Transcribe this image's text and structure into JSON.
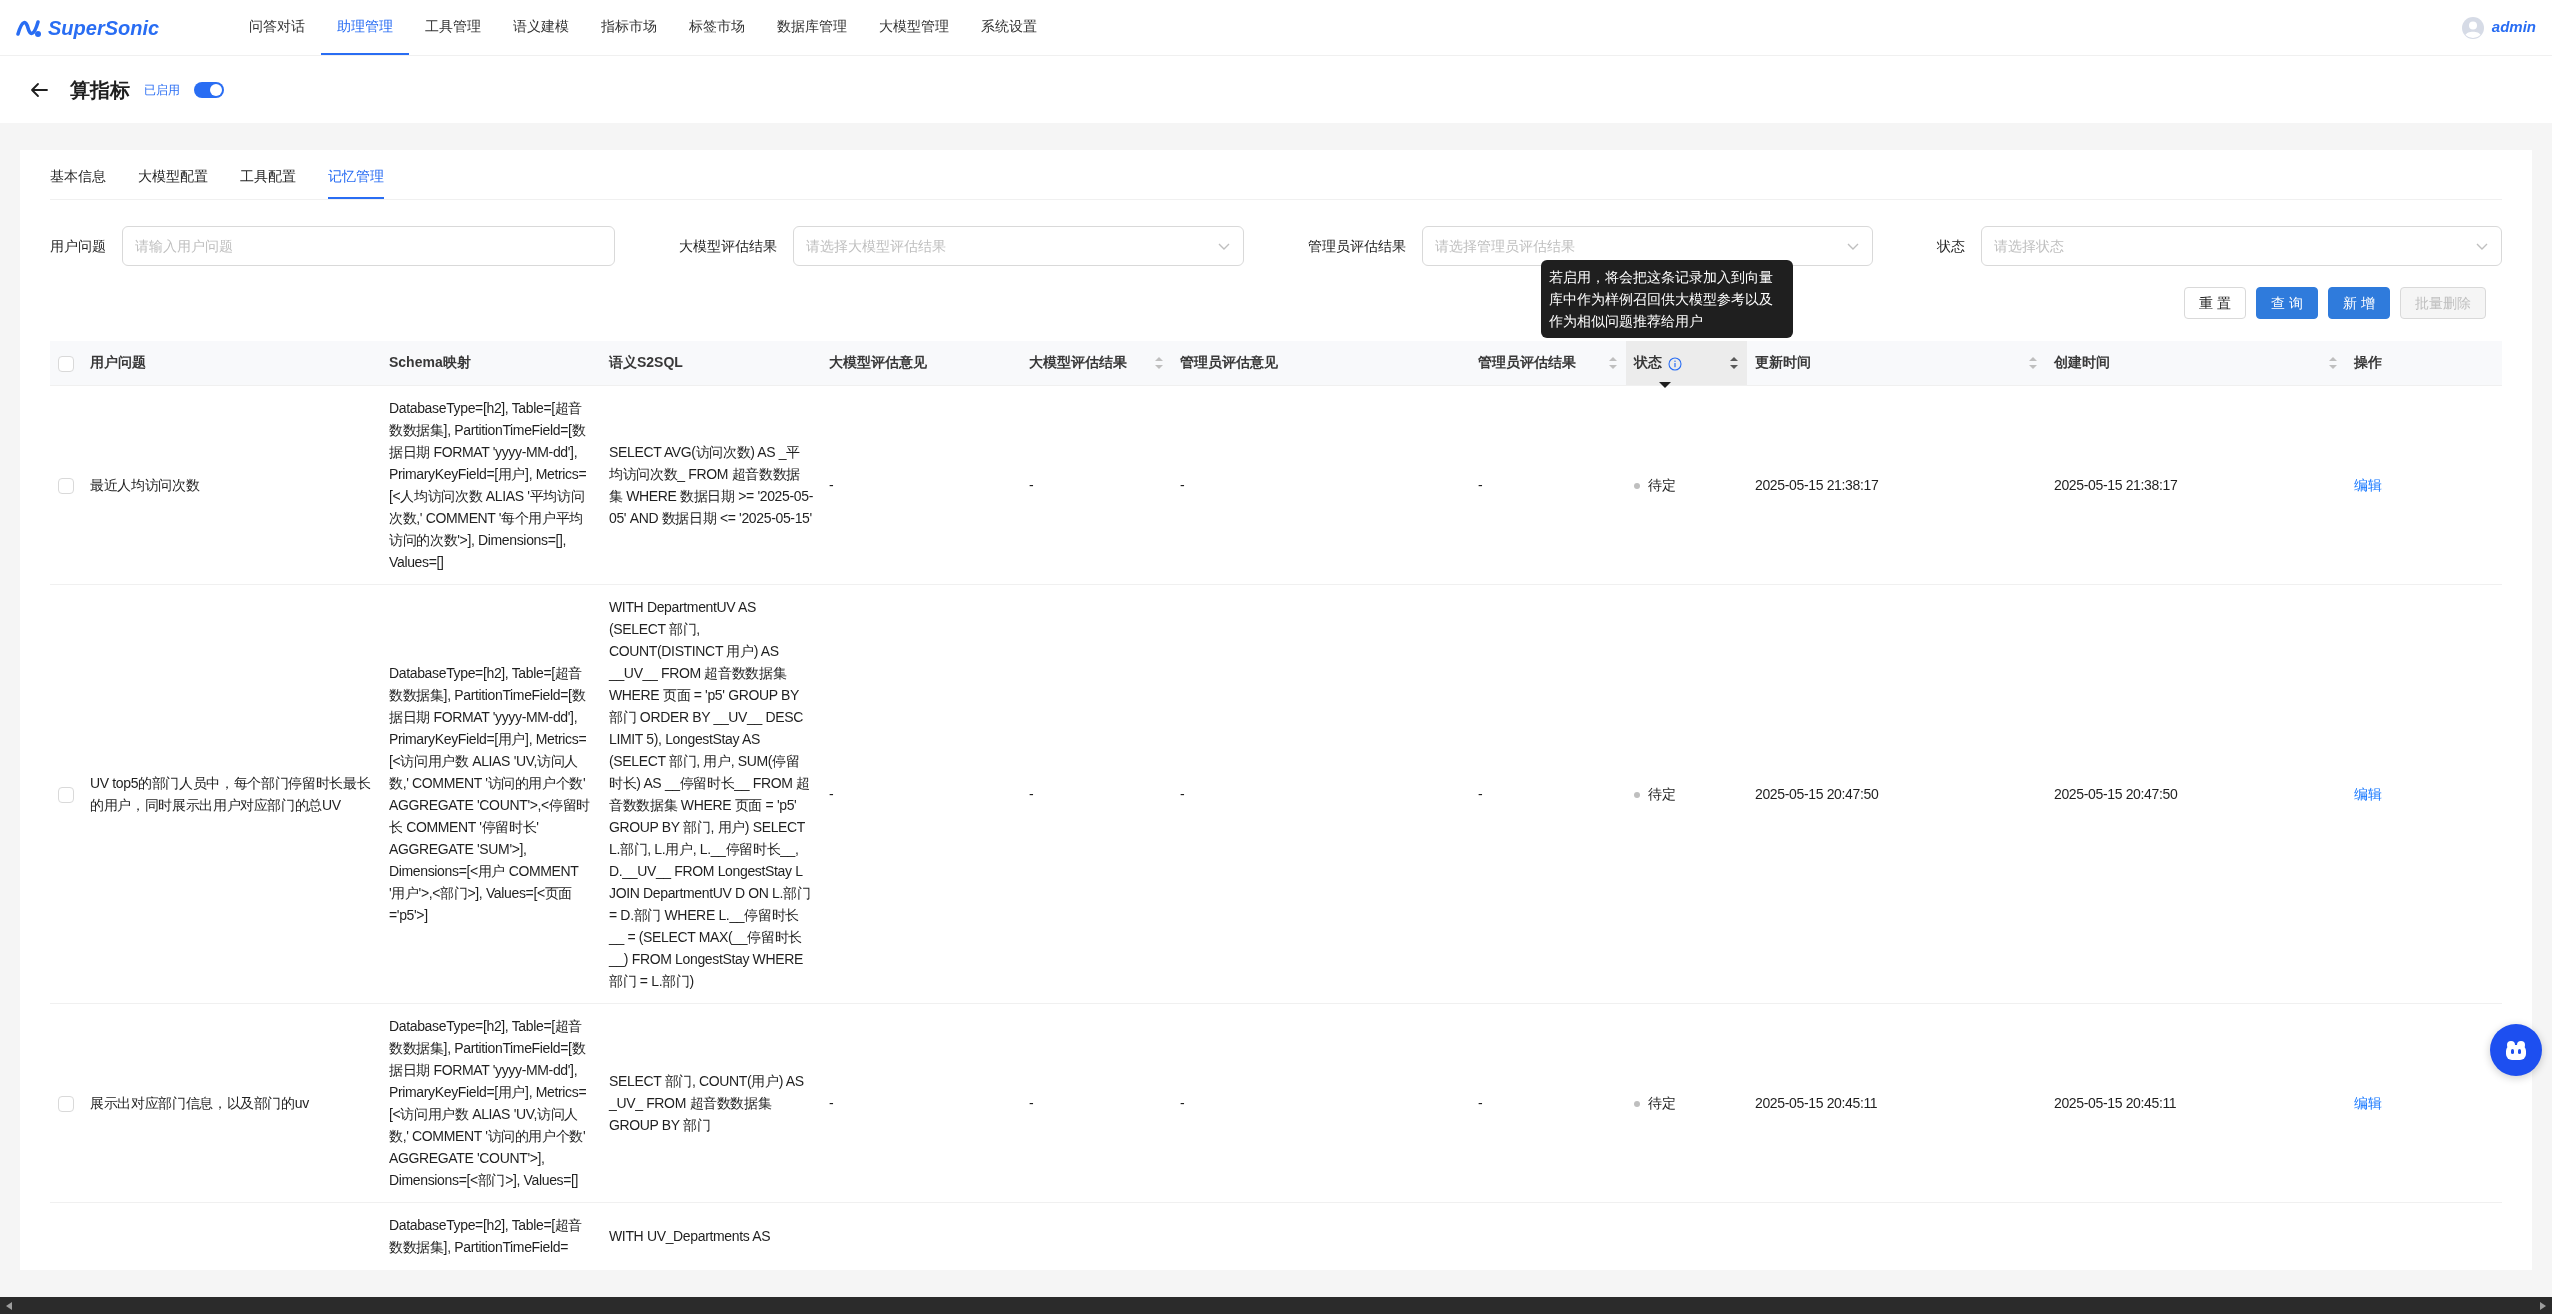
{
  "app": {
    "logo_text": "SuperSonic",
    "user": "admin",
    "nav": [
      {
        "label": "问答对话",
        "selected": false
      },
      {
        "label": "助理管理",
        "selected": true
      },
      {
        "label": "工具管理",
        "selected": false
      },
      {
        "label": "语义建模",
        "selected": false
      },
      {
        "label": "指标市场",
        "selected": false
      },
      {
        "label": "标签市场",
        "selected": false
      },
      {
        "label": "数据库管理",
        "selected": false
      },
      {
        "label": "大模型管理",
        "selected": false
      },
      {
        "label": "系统设置",
        "selected": false
      }
    ]
  },
  "page": {
    "title": "算指标",
    "enabled_label": "已启用",
    "enabled": true
  },
  "tabs": [
    {
      "label": "基本信息",
      "selected": false
    },
    {
      "label": "大模型配置",
      "selected": false
    },
    {
      "label": "工具配置",
      "selected": false
    },
    {
      "label": "记忆管理",
      "selected": true
    }
  ],
  "filters": [
    {
      "label": "用户问题",
      "kind": "input",
      "placeholder": "请输入用户问题"
    },
    {
      "label": "大模型评估结果",
      "kind": "select",
      "placeholder": "请选择大模型评估结果"
    },
    {
      "label": "管理员评估结果",
      "kind": "select",
      "placeholder": "请选择管理员评估结果"
    },
    {
      "label": "状态",
      "kind": "select",
      "placeholder": "请选择状态"
    }
  ],
  "buttons": [
    {
      "label": "重 置",
      "kind": "default",
      "disabled": false
    },
    {
      "label": "查 询",
      "kind": "primary",
      "disabled": false
    },
    {
      "label": "新 增",
      "kind": "primary",
      "disabled": false
    },
    {
      "label": "批量删除",
      "kind": "default",
      "disabled": true
    }
  ],
  "tooltip": "若启用，将会把这条记录加入到向量库中作为样例召回供大模型参考以及作为相似问题推荐给用户",
  "table": {
    "select_all_checked": false,
    "columns": [
      {
        "label": "用户问题",
        "sortable": false,
        "info": false,
        "highlighted": false
      },
      {
        "label": "Schema映射",
        "sortable": false,
        "info": false,
        "highlighted": false
      },
      {
        "label": "语义S2SQL",
        "sortable": false,
        "info": false,
        "highlighted": false
      },
      {
        "label": "大模型评估意见",
        "sortable": false,
        "info": false,
        "highlighted": false
      },
      {
        "label": "大模型评估结果",
        "sortable": true,
        "info": false,
        "highlighted": false
      },
      {
        "label": "管理员评估意见",
        "sortable": false,
        "info": false,
        "highlighted": false
      },
      {
        "label": "管理员评估结果",
        "sortable": true,
        "info": false,
        "highlighted": false
      },
      {
        "label": "状态",
        "sortable": true,
        "info": true,
        "highlighted": true
      },
      {
        "label": "更新时间",
        "sortable": true,
        "info": false,
        "highlighted": false
      },
      {
        "label": "创建时间",
        "sortable": true,
        "info": false,
        "highlighted": false
      },
      {
        "label": "操作",
        "sortable": false,
        "info": false,
        "highlighted": false
      }
    ],
    "rows": [
      {
        "checked": false,
        "cells": [
          "最近人均访问次数",
          "DatabaseType=[h2], Table=[超音数数据集], PartitionTimeField=[数据日期 FORMAT 'yyyy-MM-dd'], PrimaryKeyField=[用户], Metrics=[<人均访问次数 ALIAS '平均访问次数,' COMMENT '每个用户平均访问的次数'>], Dimensions=[], Values=[]",
          "SELECT AVG(访问次数) AS _平均访问次数_ FROM 超音数数据集 WHERE 数据日期 >= '2025-05-05' AND 数据日期 <= '2025-05-15'",
          "-",
          "-",
          "-",
          "-",
          "待定",
          "2025-05-15 21:38:17",
          "2025-05-15 21:38:17",
          "编辑"
        ]
      },
      {
        "checked": false,
        "cells": [
          "UV top5的部门人员中，每个部门停留时长最长的用户，同时展示出用户对应部门的总UV",
          "DatabaseType=[h2], Table=[超音数数据集], PartitionTimeField=[数据日期 FORMAT 'yyyy-MM-dd'], PrimaryKeyField=[用户], Metrics=[<访问用户数 ALIAS 'UV,访问人数,' COMMENT '访问的用户个数' AGGREGATE 'COUNT'>,<停留时长 COMMENT '停留时长' AGGREGATE 'SUM'>], Dimensions=[<用户 COMMENT '用户'>,<部门>], Values=[<页面='p5'>]",
          "WITH DepartmentUV AS (SELECT 部门, COUNT(DISTINCT 用户) AS __UV__ FROM 超音数数据集 WHERE 页面 = 'p5' GROUP BY 部门 ORDER BY __UV__ DESC LIMIT 5), LongestStay AS (SELECT 部门, 用户, SUM(停留时长) AS __停留时长__ FROM 超音数数据集 WHERE 页面 = 'p5' GROUP BY 部门, 用户) SELECT L.部门, L.用户, L.__停留时长__, D.__UV__ FROM LongestStay L JOIN DepartmentUV D ON L.部门 = D.部门 WHERE L.__停留时长__ = (SELECT MAX(__停留时长__) FROM LongestStay WHERE 部门 = L.部门)",
          "-",
          "-",
          "-",
          "-",
          "待定",
          "2025-05-15 20:47:50",
          "2025-05-15 20:47:50",
          "编辑"
        ]
      },
      {
        "checked": false,
        "cells": [
          "展示出对应部门信息，以及部门的uv",
          "DatabaseType=[h2], Table=[超音数数据集], PartitionTimeField=[数据日期 FORMAT 'yyyy-MM-dd'], PrimaryKeyField=[用户], Metrics=[<访问用户数 ALIAS 'UV,访问人数,' COMMENT '访问的用户个数' AGGREGATE 'COUNT'>], Dimensions=[<部门>], Values=[]",
          "SELECT 部门, COUNT(用户) AS _UV_ FROM 超音数数据集 GROUP BY 部门",
          "-",
          "-",
          "-",
          "-",
          "待定",
          "2025-05-15 20:45:11",
          "2025-05-15 20:45:11",
          "编辑"
        ]
      },
      {
        "cells": [
          null,
          "DatabaseType=[h2], Table=[超音数数据集], PartitionTimeField=",
          "WITH UV_Departments AS"
        ]
      }
    ]
  }
}
